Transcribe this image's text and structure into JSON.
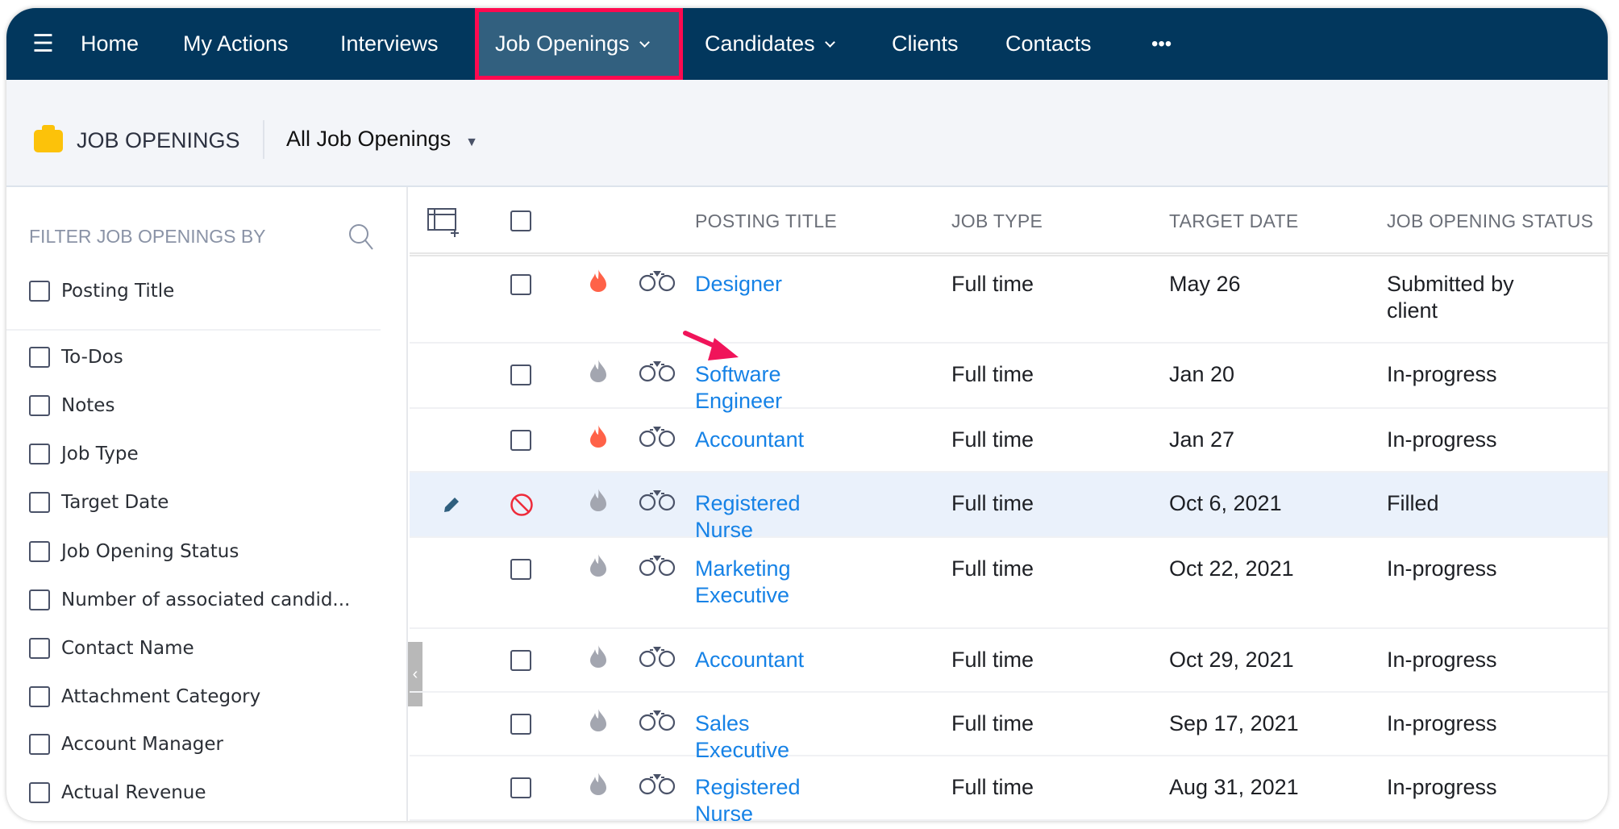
{
  "nav": {
    "items": [
      "Home",
      "My Actions",
      "Interviews",
      "Job Openings",
      "Candidates",
      "Clients",
      "Contacts"
    ],
    "active": "Job Openings",
    "more": "•••"
  },
  "subheader": {
    "module": "JOB OPENINGS",
    "view": "All Job Openings"
  },
  "filter": {
    "title": "FILTER JOB OPENINGS BY",
    "items": [
      "Posting Title",
      "To-Dos",
      "Notes",
      "Job Type",
      "Target Date",
      "Job Opening Status",
      "Number of associated candid...",
      "Contact Name",
      "Attachment Category",
      "Account Manager",
      "Actual Revenue"
    ]
  },
  "table": {
    "columns": [
      "POSTING TITLE",
      "JOB TYPE",
      "TARGET DATE",
      "JOB OPENING STATUS"
    ],
    "rows": [
      {
        "title": "Designer",
        "type": "Full time",
        "date": "May 26",
        "status": "Submitted by client",
        "hot": true
      },
      {
        "title": "Software Engineer",
        "type": "Full time",
        "date": "Jan 20",
        "status": "In-progress",
        "hot": false
      },
      {
        "title": "Accountant",
        "type": "Full time",
        "date": "Jan 27",
        "status": "In-progress",
        "hot": true
      },
      {
        "title": "Registered Nurse",
        "type": "Full time",
        "date": "Oct 6, 2021",
        "status": "Filled",
        "hot": false,
        "highlighted": true
      },
      {
        "title": "Marketing Executive",
        "type": "Full time",
        "date": "Oct 22, 2021",
        "status": "In-progress",
        "hot": false
      },
      {
        "title": "Accountant",
        "type": "Full time",
        "date": "Oct 29, 2021",
        "status": "In-progress",
        "hot": false
      },
      {
        "title": "Sales Executive",
        "type": "Full time",
        "date": "Sep 17, 2021",
        "status": "In-progress",
        "hot": false
      },
      {
        "title": "Registered Nurse",
        "type": "Full time",
        "date": "Aug 31, 2021",
        "status": "In-progress",
        "hot": false
      }
    ]
  },
  "colors": {
    "nav": "#02375d",
    "active_tab": "#32607f",
    "highlight_border": "#ff0a50",
    "link": "#1682e6",
    "hot": "#ff6248",
    "cold": "#a3a6b0",
    "annotation_arrow": "#f0145a"
  }
}
